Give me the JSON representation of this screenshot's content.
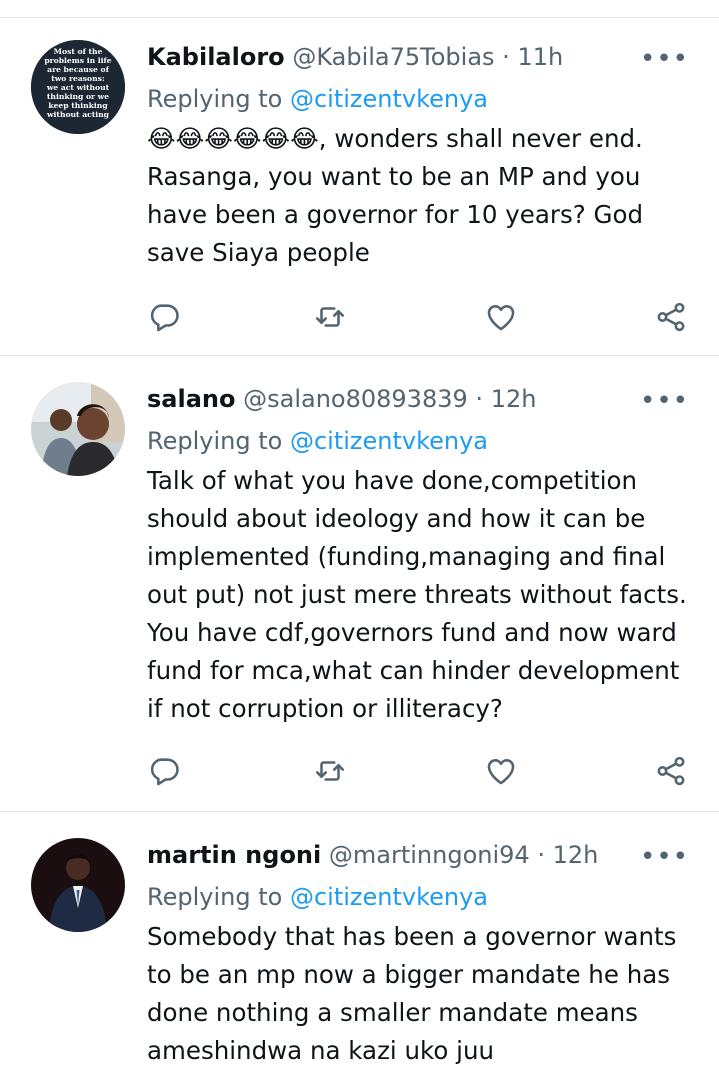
{
  "colors": {
    "text": "#0f1419",
    "secondary": "#536471",
    "link": "#1d9bf0",
    "divider": "#e4e7ea"
  },
  "icons": {
    "more": "more-dots-icon",
    "reply": "reply-bubble-icon",
    "retweet": "retweet-icon",
    "like": "heart-icon",
    "share": "share-icon"
  },
  "tweets": [
    {
      "display_name": "Kabilaloro",
      "handle": "@Kabila75Tobias",
      "separator": "·",
      "time": "11h",
      "more": "•••",
      "replying_prefix": "Replying to",
      "replying_handle": "@citizentvkenya",
      "emojis": "😂😂😂😂😂😂",
      "text": ", wonders shall never end. Rasanga, you want to be an MP and you have been a governor for 10 years? God save Siaya people",
      "avatar_text": [
        "Most of the",
        "problems in life",
        "are because of",
        "two reasons:",
        "we act without",
        "thinking or we",
        "keep thinking",
        "without acting"
      ]
    },
    {
      "display_name": "salano",
      "handle": "@salano80893839",
      "separator": "·",
      "time": "12h",
      "more": "•••",
      "replying_prefix": "Replying to",
      "replying_handle": "@citizentvkenya",
      "text": "Talk of what you have done,competition should about ideology and how it can be implemented (funding,managing and final out put) not just mere threats without facts. You have cdf,governors fund and now ward fund for mca,what can hinder development if not corruption or illiteracy?"
    },
    {
      "display_name": "martin ngoni",
      "handle": "@martinngoni94",
      "separator": "·",
      "time": "12h",
      "more": "•••",
      "replying_prefix": "Replying to",
      "replying_handle": "@citizentvkenya",
      "text": "Somebody that has been a governor wants to be an mp now a bigger mandate he has done nothing a smaller mandate means ameshindwa na kazi uko juu"
    }
  ]
}
